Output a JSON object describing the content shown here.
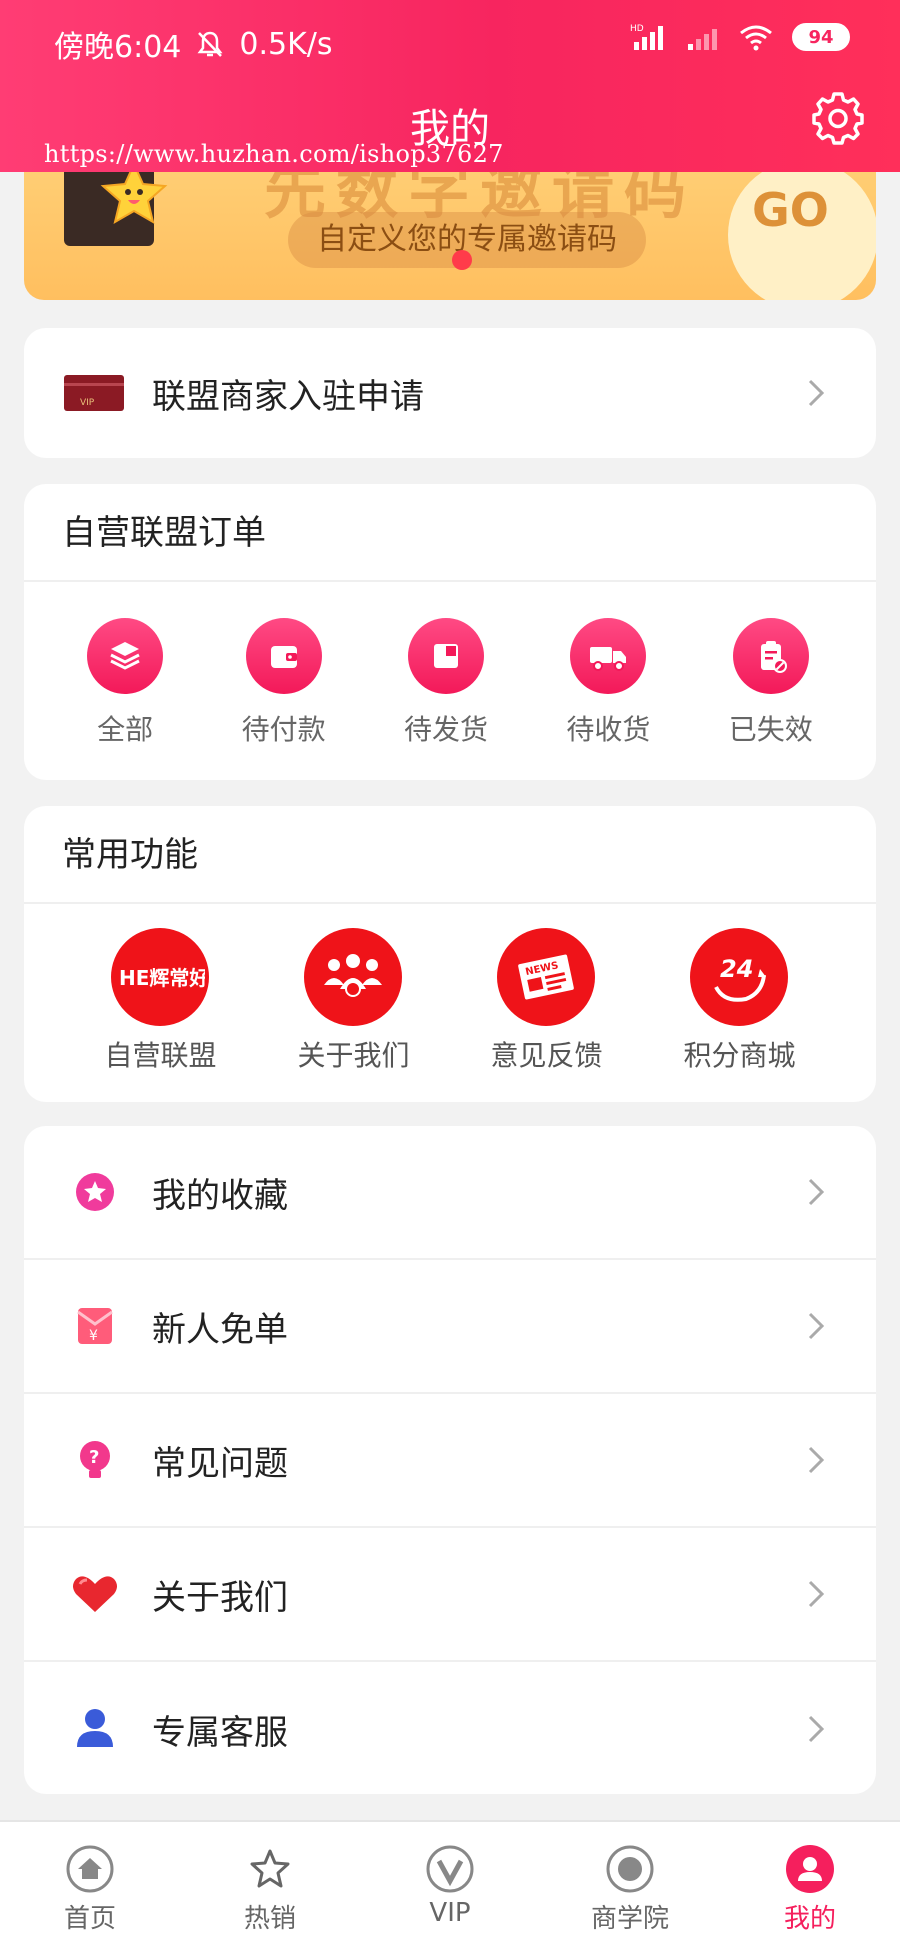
{
  "status_bar": {
    "time": "傍晚6:04",
    "speed": "0.5K/s",
    "network_tag": "HD",
    "battery": "94"
  },
  "header": {
    "title": "我的",
    "watermark": "https://www.huzhan.com/ishop37627"
  },
  "banner": {
    "heading": "先数字邀请码",
    "subtitle": "自定义您的专属邀请码",
    "button": "GO"
  },
  "merchant": {
    "card_tag": "VIP",
    "label": "联盟商家入驻申请"
  },
  "orders": {
    "title": "自营联盟订单",
    "items": [
      {
        "label": "全部",
        "icon": "layers-icon"
      },
      {
        "label": "待付款",
        "icon": "wallet-icon"
      },
      {
        "label": "待发货",
        "icon": "box-icon"
      },
      {
        "label": "待收货",
        "icon": "truck-icon"
      },
      {
        "label": "已失效",
        "icon": "expired-clipboard-icon"
      }
    ]
  },
  "functions": {
    "title": "常用功能",
    "items": [
      {
        "label": "自营联盟",
        "icon": "alliance-logo-icon",
        "logo_text": "HE辉常好"
      },
      {
        "label": "关于我们",
        "icon": "team-icon"
      },
      {
        "label": "意见反馈",
        "icon": "news-icon",
        "logo_text": "NEWS"
      },
      {
        "label": "积分商城",
        "icon": "clock-24-icon",
        "logo_text": "24"
      }
    ]
  },
  "menu": {
    "items": [
      {
        "label": "我的收藏",
        "icon": "favorite-star-icon"
      },
      {
        "label": "新人免单",
        "icon": "red-envelope-icon"
      },
      {
        "label": "常见问题",
        "icon": "question-bulb-icon"
      },
      {
        "label": "关于我们",
        "icon": "heart-icon"
      },
      {
        "label": "专属客服",
        "icon": "user-service-icon"
      }
    ]
  },
  "bottom_nav": {
    "items": [
      {
        "label": "首页",
        "icon": "home-icon"
      },
      {
        "label": "热销",
        "icon": "star-icon"
      },
      {
        "label": "VIP",
        "icon": "vip-icon"
      },
      {
        "label": "商学院",
        "icon": "academy-icon"
      },
      {
        "label": "我的",
        "icon": "profile-icon",
        "active": true
      }
    ]
  },
  "colors": {
    "primary": "#f7255f",
    "banner": "#ffc56a",
    "function_red": "#ef1319"
  }
}
